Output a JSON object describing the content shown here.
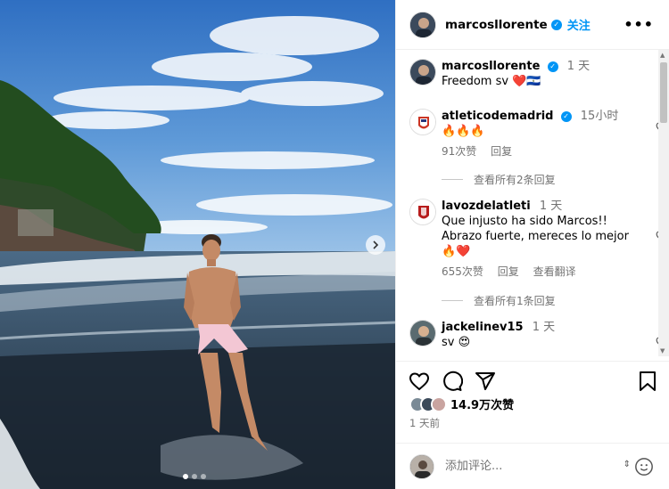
{
  "post": {
    "author": "marcosllorente",
    "follow_label": "关注",
    "more_label": "•••",
    "caption_time": "1 天",
    "caption_text": "Freedom sv",
    "caption_emoji": "❤️🇸🇻"
  },
  "comments": [
    {
      "user": "atleticodemadrid",
      "time": "15小时",
      "text": "🔥🔥🔥",
      "likes": "91次赞",
      "reply_label": "回复",
      "translate_label": "",
      "view_replies": "查看所有2条回复"
    },
    {
      "user": "lavozdelatleti",
      "time": "1 天",
      "text": "Que injusto ha sido Marcos!! Abrazo fuerte, mereces lo mejor",
      "text_emoji": "🔥❤️",
      "likes": "655次赞",
      "reply_label": "回复",
      "translate_label": "查看翻译",
      "view_replies": "查看所有1条回复"
    },
    {
      "user": "jackelinev15",
      "time": "1 天",
      "text": "sv",
      "text_emoji": "😍"
    }
  ],
  "footer": {
    "likes_count": "14.9万次赞",
    "posted_ago": "1 天前",
    "comment_placeholder": "添加评论..."
  },
  "colors": {
    "accent": "#0095f6",
    "muted": "#737373",
    "heart_red": "#e0245e"
  },
  "icons": [
    "verified-badge-icon",
    "more-options-icon",
    "heart-icon",
    "comment-icon",
    "share-icon",
    "bookmark-icon",
    "emoji-icon",
    "next-arrow-icon",
    "scroll-arrow-icon"
  ]
}
